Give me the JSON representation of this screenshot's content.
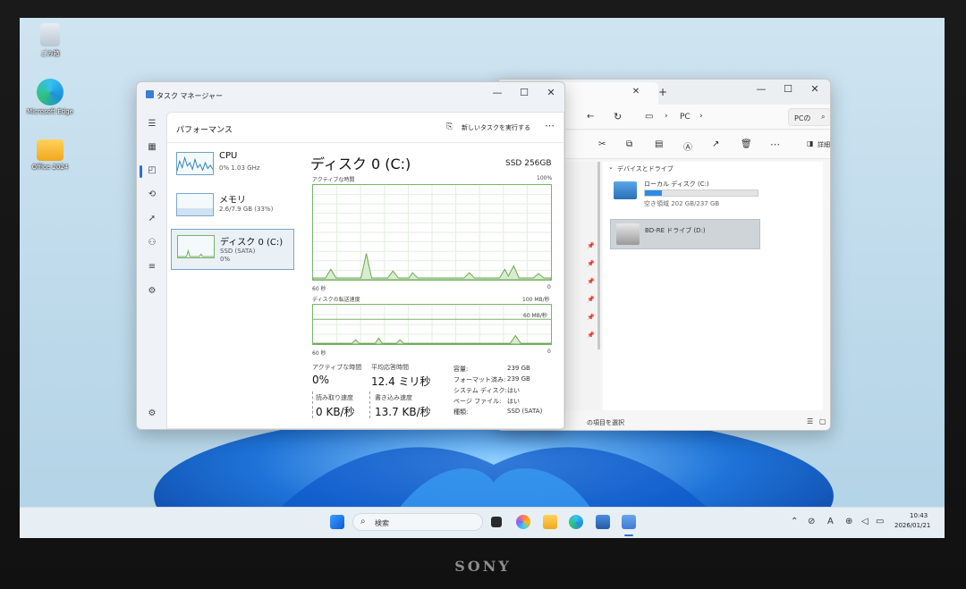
{
  "desktop": {
    "icons": [
      {
        "label": "ごみ箱"
      },
      {
        "label": "Microsoft Edge"
      },
      {
        "label": "Office 2024"
      }
    ]
  },
  "taskmanager": {
    "title": "タスク マネージャー",
    "section": "パフォーマンス",
    "run_task": "新しいタスクを実行する",
    "more": "⋯",
    "resources": [
      {
        "name": "CPU",
        "line1": "0%  1.03 GHz",
        "line2": ""
      },
      {
        "name": "メモリ",
        "line1": "2.6/7.9 GB (33%)",
        "line2": ""
      },
      {
        "name": "ディスク 0 (C:)",
        "line1": "SSD (SATA)",
        "line2": "0%"
      }
    ],
    "detail": {
      "title": "ディスク 0 (C:)",
      "model": "SSD 256GB",
      "graph1_label": "アクティブな時間",
      "graph1_max": "100%",
      "graph1_xleft": "60 秒",
      "graph1_xright": "0",
      "graph2_label": "ディスクの転送速度",
      "graph2_max": "100 MB/秒",
      "graph2_mid": "60 MB/秒",
      "graph2_xleft": "60 秒",
      "graph2_xright": "0",
      "active_time_label": "アクティブな時間",
      "active_time_value": "0%",
      "avg_resp_label": "平均応答時間",
      "avg_resp_value": "12.4 ミリ秒",
      "read_label": "読み取り速度",
      "read_value": "0 KB/秒",
      "write_label": "書き込み速度",
      "write_value": "13.7 KB/秒",
      "props": [
        {
          "k": "容量:",
          "v": "239 GB"
        },
        {
          "k": "フォーマット済み:",
          "v": "239 GB"
        },
        {
          "k": "システム ディスク:",
          "v": "はい"
        },
        {
          "k": "ページ ファイル:",
          "v": "はい"
        },
        {
          "k": "種類:",
          "v": "SSD (SATA)"
        }
      ]
    }
  },
  "explorer": {
    "tab_close": "✕",
    "tab_new": "+",
    "breadcrumb_pc": "PC",
    "search_placeholder": "PCの",
    "details_label": "詳細",
    "section": "デバイスとドライブ",
    "drives": [
      {
        "name": "ローカル ディスク (C:)",
        "free": "空き領域 202 GB/237 GB",
        "used_fraction": 0.15
      },
      {
        "name": "BD-RE ドライブ (D:)",
        "free": ""
      }
    ],
    "status": "の項目を選択"
  },
  "taskbar": {
    "search": "検索",
    "time": "10:43",
    "date": "2026/01/21",
    "ime": "A"
  },
  "brand": "SONY"
}
